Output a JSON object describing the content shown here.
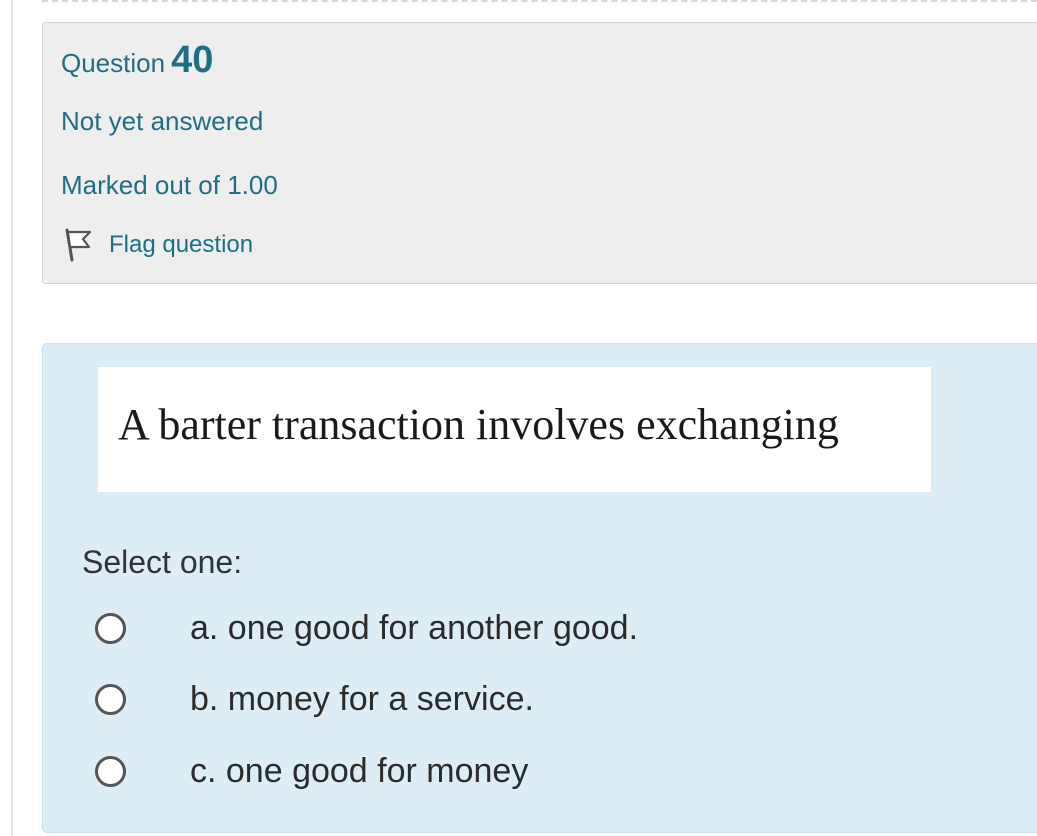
{
  "info": {
    "question_word": "Question",
    "question_number": "40",
    "state": "Not yet answered",
    "grade": "Marked out of 1.00",
    "flag_label": "Flag question"
  },
  "question": {
    "text": "A barter transaction involves exchanging",
    "prompt": "Select one:",
    "options": [
      {
        "label": "a. one good for another good.",
        "selected": false
      },
      {
        "label": "b. money for a service.",
        "selected": false
      },
      {
        "label": "c. one good for money",
        "selected": false
      }
    ]
  },
  "colors": {
    "link_teal": "#1e6f86",
    "info_bg": "#eeeeee",
    "question_bg": "#dcedf5"
  },
  "icons": {
    "flag": "flag-outline-icon",
    "radio": "radio-unchecked-icon"
  }
}
